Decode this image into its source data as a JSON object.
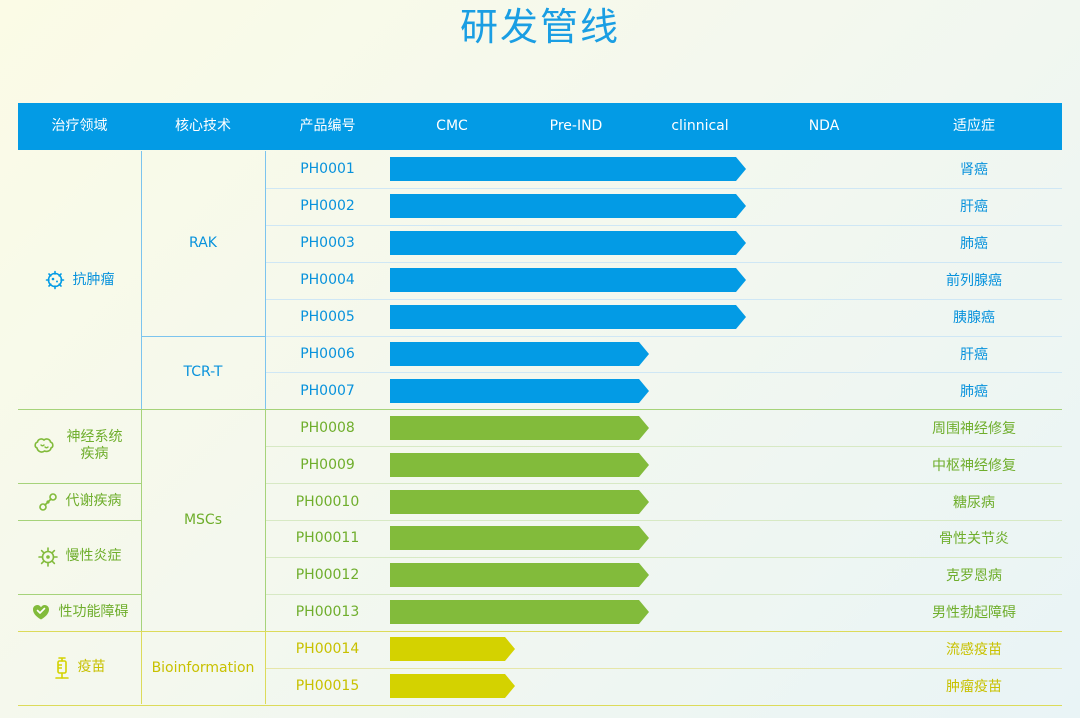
{
  "page": {
    "title": "研发管线"
  },
  "headers": [
    "治疗领域",
    "核心技术",
    "产品编号",
    "CMC",
    "Pre-IND",
    "clinnical",
    "NDA",
    "适应症"
  ],
  "colors": {
    "header_bg": "#039be5",
    "blue": "#039be5",
    "green": "#82bb3b",
    "yellow": "#d4d200",
    "blue_text": "#0892dc",
    "green_text": "#6fae2c",
    "yellow_text": "#c8c100"
  },
  "areas": [
    {
      "label": "抗肿瘤",
      "icon": "tumor-cell-icon",
      "group": "blue"
    },
    {
      "label": "神经系统疾病",
      "icon": "brain-icon",
      "group": "green"
    },
    {
      "label": "代谢疾病",
      "icon": "molecule-icon",
      "group": "green"
    },
    {
      "label": "慢性炎症",
      "icon": "virus-icon",
      "group": "green"
    },
    {
      "label": "性功能障碍",
      "icon": "heart-shield-icon",
      "group": "green"
    },
    {
      "label": "疫苗",
      "icon": "syringe-icon",
      "group": "yellow"
    }
  ],
  "technologies": [
    {
      "label": "RAK",
      "group": "blue"
    },
    {
      "label": "TCR-T",
      "group": "blue"
    },
    {
      "label": "MSCs",
      "group": "green"
    },
    {
      "label": "Bioinformation",
      "group": "yellow"
    }
  ],
  "products": [
    {
      "code": "PH0001",
      "indication": "肾癌",
      "group": "blue",
      "progress": 0.88
    },
    {
      "code": "PH0002",
      "indication": "肝癌",
      "group": "blue",
      "progress": 0.88
    },
    {
      "code": "PH0003",
      "indication": "肺癌",
      "group": "blue",
      "progress": 0.88
    },
    {
      "code": "PH0004",
      "indication": "前列腺癌",
      "group": "blue",
      "progress": 0.88
    },
    {
      "code": "PH0005",
      "indication": "胰腺癌",
      "group": "blue",
      "progress": 0.88
    },
    {
      "code": "PH0006",
      "indication": "肝癌",
      "group": "blue",
      "progress": 0.64
    },
    {
      "code": "PH0007",
      "indication": "肺癌",
      "group": "blue",
      "progress": 0.64
    },
    {
      "code": "PH0008",
      "indication": "周围神经修复",
      "group": "green",
      "progress": 0.64
    },
    {
      "code": "PH0009",
      "indication": "中枢神经修复",
      "group": "green",
      "progress": 0.64
    },
    {
      "code": "PH00010",
      "indication": "糖尿病",
      "group": "green",
      "progress": 0.64
    },
    {
      "code": "PH00011",
      "indication": "骨性关节炎",
      "group": "green",
      "progress": 0.64
    },
    {
      "code": "PH00012",
      "indication": "克罗恩病",
      "group": "green",
      "progress": 0.64
    },
    {
      "code": "PH00013",
      "indication": "男性勃起障碍",
      "group": "green",
      "progress": 0.64
    },
    {
      "code": "PH00014",
      "indication": "流感疫苗",
      "group": "yellow",
      "progress": 0.31
    },
    {
      "code": "PH00015",
      "indication": "肿瘤疫苗",
      "group": "yellow",
      "progress": 0.31
    }
  ]
}
